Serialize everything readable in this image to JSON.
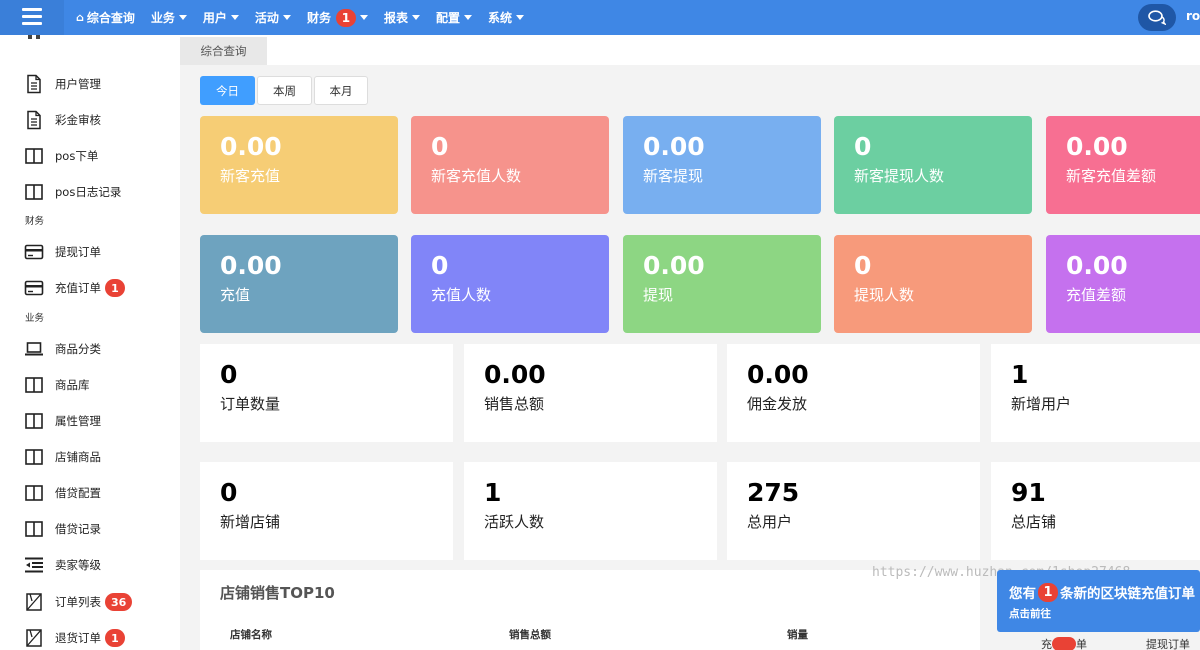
{
  "topbar": {
    "nav": [
      {
        "label": "综合查询",
        "icon": "home-icon"
      },
      {
        "label": "业务",
        "caret": true
      },
      {
        "label": "用户",
        "caret": true
      },
      {
        "label": "活动",
        "caret": true
      },
      {
        "label": "财务",
        "badge": "1",
        "caret": true
      },
      {
        "label": "报表",
        "caret": true
      },
      {
        "label": "配置",
        "caret": true
      },
      {
        "label": "系统",
        "caret": true
      }
    ],
    "user": "roo"
  },
  "sidebar": {
    "items": [
      {
        "label": "用户管理",
        "icon": "document-icon"
      },
      {
        "label": "彩金审核",
        "icon": "document-icon"
      },
      {
        "label": "pos下单",
        "icon": "columns-icon"
      },
      {
        "label": "pos日志记录",
        "icon": "columns-icon"
      },
      {
        "label": "提现订单",
        "icon": "credit-card-icon"
      },
      {
        "label": "充值订单",
        "icon": "credit-card-icon",
        "badge": "1"
      },
      {
        "label": "商品分类",
        "icon": "laptop-icon"
      },
      {
        "label": "商品库",
        "icon": "columns-icon"
      },
      {
        "label": "属性管理",
        "icon": "columns-icon"
      },
      {
        "label": "店铺商品",
        "icon": "columns-icon"
      },
      {
        "label": "借贷配置",
        "icon": "columns-icon"
      },
      {
        "label": "借贷记录",
        "icon": "columns-icon"
      },
      {
        "label": "卖家等级",
        "icon": "indent-icon"
      },
      {
        "label": "订单列表",
        "icon": "box-cross-icon",
        "badge": "36"
      },
      {
        "label": "退货订单",
        "icon": "box-cross-icon",
        "badge": "1"
      }
    ],
    "sections": [
      "财务",
      "业务"
    ]
  },
  "tabs": {
    "active": "综合查询"
  },
  "periods": [
    "今日",
    "本周",
    "本月"
  ],
  "cards_row1": [
    {
      "value": "0.00",
      "label": "新客充值",
      "color": "#f6cd75"
    },
    {
      "value": "0",
      "label": "新客充值人数",
      "color": "#f6938c"
    },
    {
      "value": "0.00",
      "label": "新客提现",
      "color": "#78aff0"
    },
    {
      "value": "0",
      "label": "新客提现人数",
      "color": "#6ccfa1"
    },
    {
      "value": "0.00",
      "label": "新客充值差额",
      "color": "#f76f92"
    }
  ],
  "cards_row2": [
    {
      "value": "0.00",
      "label": "充值",
      "color": "#6ea3bf"
    },
    {
      "value": "0",
      "label": "充值人数",
      "color": "#8185f8"
    },
    {
      "value": "0.00",
      "label": "提现",
      "color": "#8dd683"
    },
    {
      "value": "0",
      "label": "提现人数",
      "color": "#f79a7b"
    },
    {
      "value": "0.00",
      "label": "充值差额",
      "color": "#c571ee"
    }
  ],
  "stats_row1": [
    {
      "value": "0",
      "label": "订单数量"
    },
    {
      "value": "0.00",
      "label": "销售总额"
    },
    {
      "value": "0.00",
      "label": "佣金发放"
    },
    {
      "value": "1",
      "label": "新增用户"
    }
  ],
  "stats_row2": [
    {
      "value": "0",
      "label": "新增店铺"
    },
    {
      "value": "1",
      "label": "活跃人数"
    },
    {
      "value": "275",
      "label": "总用户"
    },
    {
      "value": "91",
      "label": "总店铺"
    }
  ],
  "top10": {
    "title": "店铺销售TOP10",
    "headers": [
      "店铺名称",
      "销售总额",
      "销量"
    ]
  },
  "watermark": "https://www.huzhan.com/1shop27468",
  "notification": {
    "prefix": "您有",
    "count": "1",
    "suffix": "条新的区块链充值订单",
    "action": "点击前往"
  },
  "bottom_peek": {
    "left": "充",
    "left_after": "单",
    "right": "提现订单"
  }
}
